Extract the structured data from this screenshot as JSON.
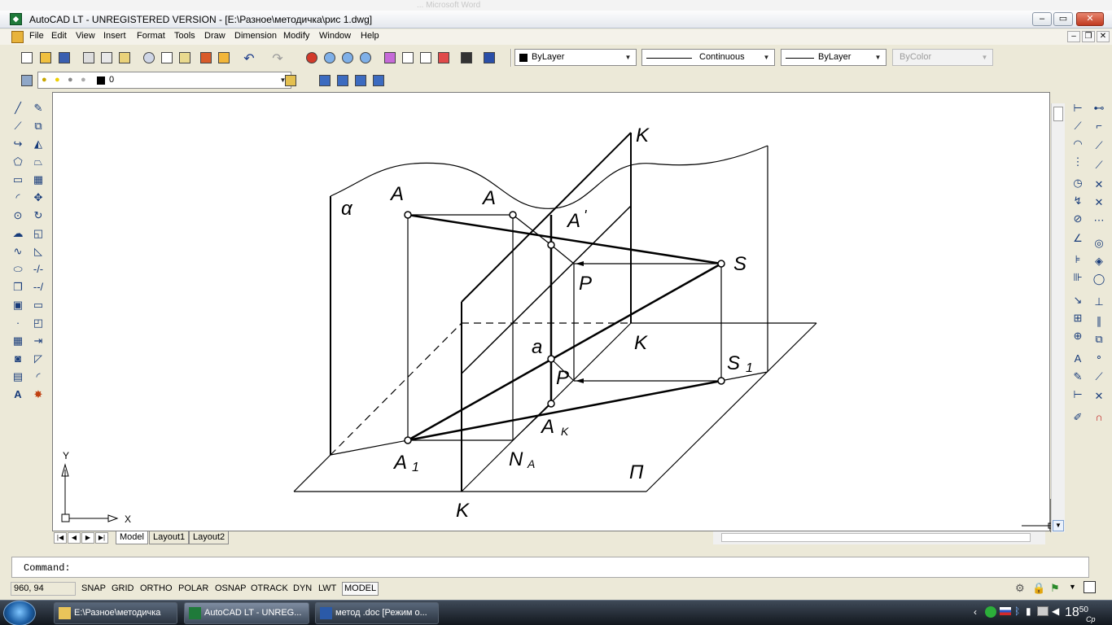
{
  "ghost_title": "   ...     Microsoft Word",
  "window": {
    "title": "AutoCAD LT - UNREGISTERED VERSION - [E:\\Разное\\методичка\\рис 1.dwg]",
    "min": "0",
    "max": "1",
    "close": "r"
  },
  "menu": [
    "File",
    "Edit",
    "View",
    "Insert",
    "Format",
    "Tools",
    "Draw",
    "Dimension",
    "Modify",
    "Window",
    "Help"
  ],
  "properties": {
    "color": "ByLayer",
    "linetype": "Continuous",
    "lineweight": "ByLayer",
    "plotstyle": "ByColor"
  },
  "layer": {
    "current": "0"
  },
  "drawing_labels": {
    "K_top": "K",
    "alpha": "α",
    "A_left": "A",
    "A_mid": "A",
    "A_prime": "A",
    "A_prime_mark": "'",
    "S": "S",
    "P_top": "P",
    "a": "a",
    "K_mid": "K",
    "S1": "S",
    "S1_sub": "1",
    "P_bottom": "P",
    "Ak": "A",
    "Ak_sub": "K",
    "A1": "A",
    "A1_sub": "1",
    "NA": "N",
    "NA_sub": "A",
    "Pi": "П",
    "K_bottom": "K"
  },
  "ucs": {
    "x": "X",
    "y": "Y"
  },
  "layout_tabs": [
    "Model",
    "Layout1",
    "Layout2"
  ],
  "command": {
    "prompt": "Command:"
  },
  "status": {
    "coords": "960, 94",
    "toggles": [
      "SNAP",
      "GRID",
      "ORTHO",
      "POLAR",
      "OSNAP",
      "OTRACK",
      "DYN",
      "LWT",
      "MODEL"
    ]
  },
  "taskbar": {
    "tasks": [
      "E:\\Разное\\методичка",
      "AutoCAD LT - UNREG...",
      "метод .doc [Режим о..."
    ],
    "time": "18",
    "time_min": "50",
    "day": "Ср"
  },
  "colors": {
    "accent": "#1f7a3a",
    "canvas": "#ffffff",
    "chrome": "#ece9d8"
  }
}
